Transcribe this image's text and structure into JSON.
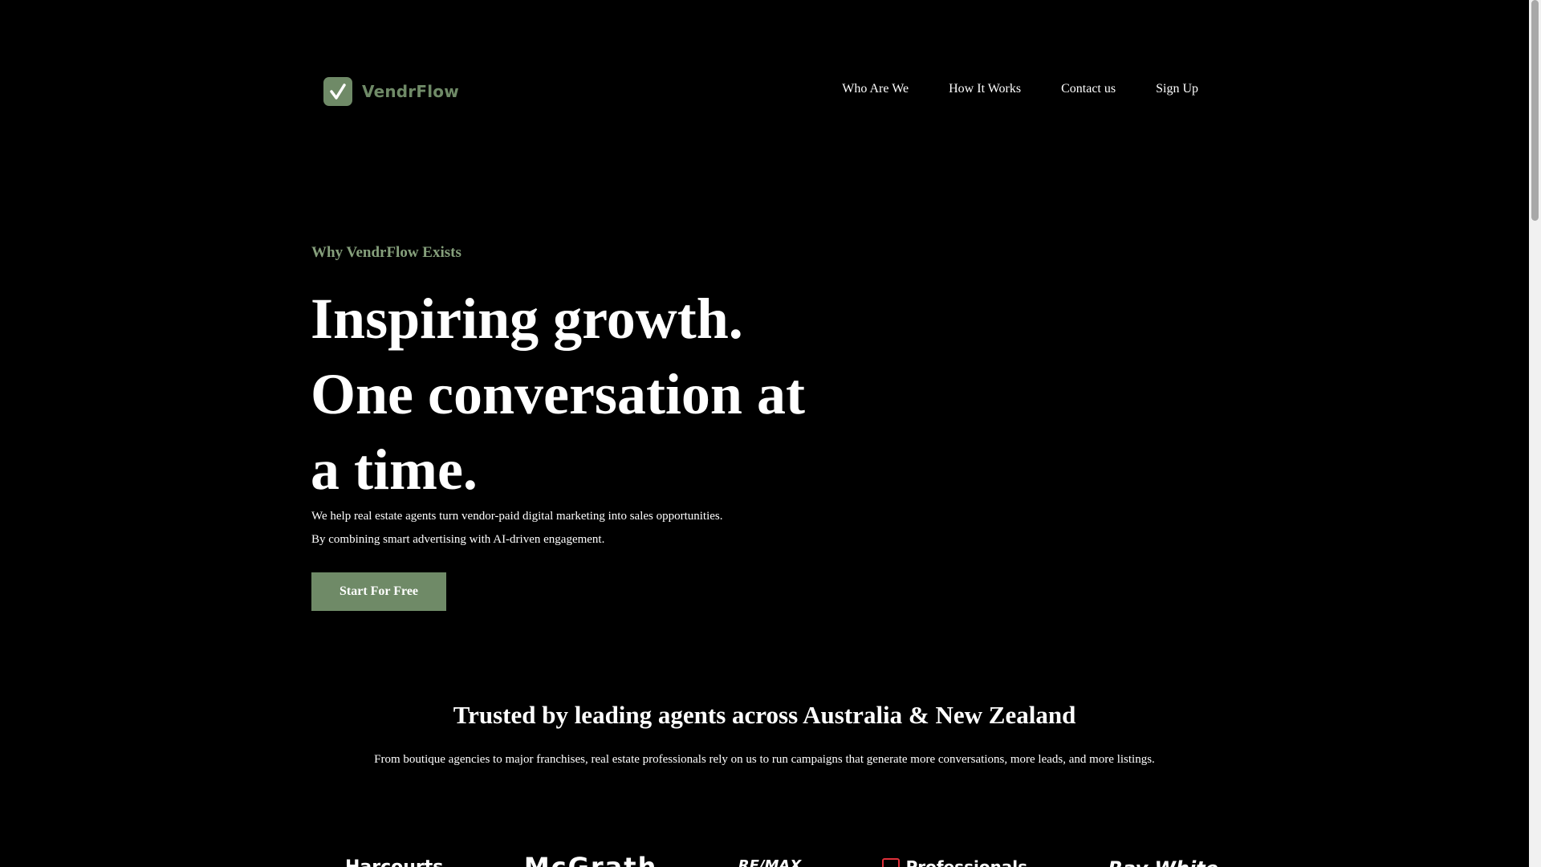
{
  "header": {
    "logo_text": "VendrFlow",
    "nav": [
      {
        "label": "Who Are We"
      },
      {
        "label": "How It Works"
      },
      {
        "label": "Contact us"
      },
      {
        "label": "Sign Up"
      }
    ]
  },
  "hero": {
    "eyebrow": "Why VendrFlow Exists",
    "headline": "Inspiring growth. One conversation at a time.",
    "subcopy": "We help real estate agents turn vendor-paid digital marketing into sales opportunities. By combining smart advertising with AI-driven engagement.",
    "cta_label": "Start For Free"
  },
  "trusted": {
    "title": "Trusted by leading agents across Australia & New Zealand",
    "subtitle": "From boutique agencies to major franchises, real estate professionals rely on us to run campaigns that generate more conversations, more leads, and more listings.",
    "brands": [
      "Harcourts",
      "McGrath",
      "RE/MAX",
      "Professionals",
      "Ray White"
    ]
  },
  "colors": {
    "background": "#000000",
    "accent": "#6f8a67",
    "eyebrow": "#86a07c",
    "text": "#ffffff"
  },
  "icons": {
    "logo": "check-icon"
  }
}
